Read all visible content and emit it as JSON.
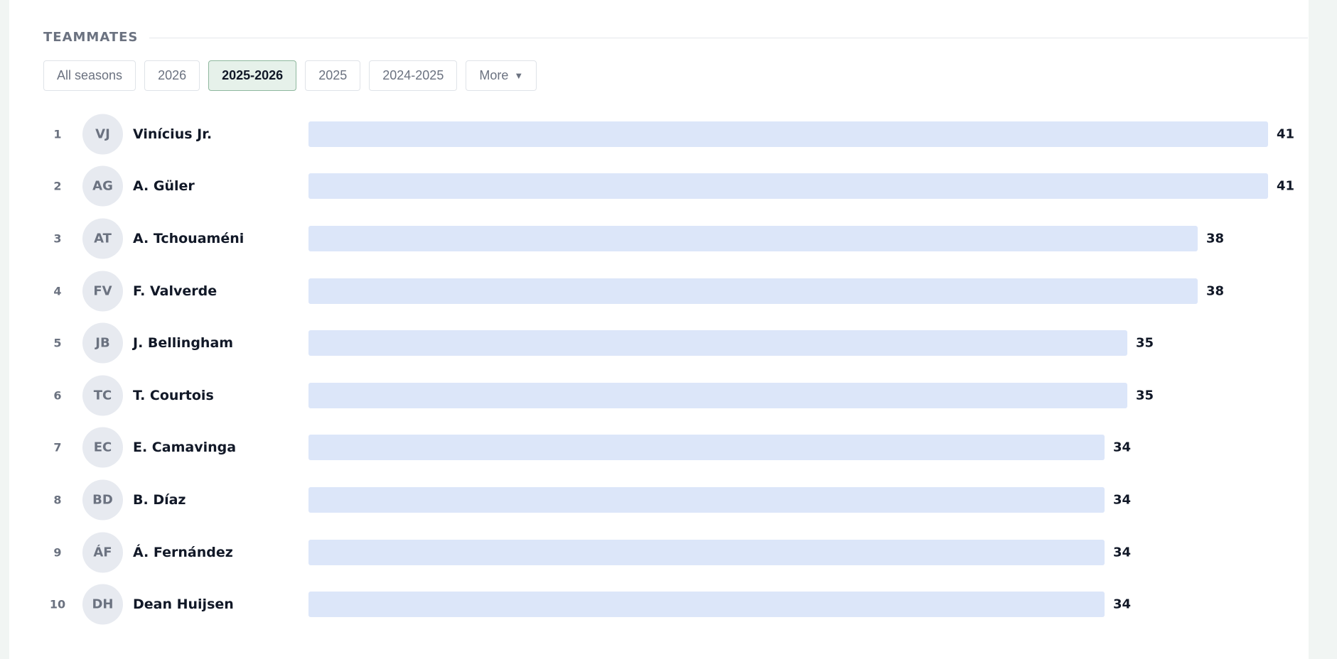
{
  "section": {
    "title": "TEAMMATES"
  },
  "filters": [
    {
      "label": "All seasons",
      "active": false
    },
    {
      "label": "2026",
      "active": false
    },
    {
      "label": "2025-2026",
      "active": true
    },
    {
      "label": "2025",
      "active": false
    },
    {
      "label": "2024-2025",
      "active": false
    },
    {
      "label": "More",
      "active": false,
      "icon": "caret-down-icon"
    }
  ],
  "max_value": 41,
  "colors": {
    "bar": "#dce6f9",
    "active_filter_bg": "#e6f1ea",
    "active_filter_border": "#8fb89e"
  },
  "teammates": [
    {
      "rank": "1",
      "initials": "VJ",
      "name": "Vinícius Jr.",
      "value": 41
    },
    {
      "rank": "2",
      "initials": "AG",
      "name": "A. Güler",
      "value": 41
    },
    {
      "rank": "3",
      "initials": "AT",
      "name": "A. Tchouaméni",
      "value": 38
    },
    {
      "rank": "4",
      "initials": "FV",
      "name": "F. Valverde",
      "value": 38
    },
    {
      "rank": "5",
      "initials": "JB",
      "name": "J. Bellingham",
      "value": 35
    },
    {
      "rank": "6",
      "initials": "TC",
      "name": "T. Courtois",
      "value": 35
    },
    {
      "rank": "7",
      "initials": "EC",
      "name": "E. Camavinga",
      "value": 34
    },
    {
      "rank": "8",
      "initials": "BD",
      "name": "B. Díaz",
      "value": 34
    },
    {
      "rank": "9",
      "initials": "ÁF",
      "name": "Á. Fernández",
      "value": 34
    },
    {
      "rank": "10",
      "initials": "DH",
      "name": "Dean Huijsen",
      "value": 34
    }
  ]
}
